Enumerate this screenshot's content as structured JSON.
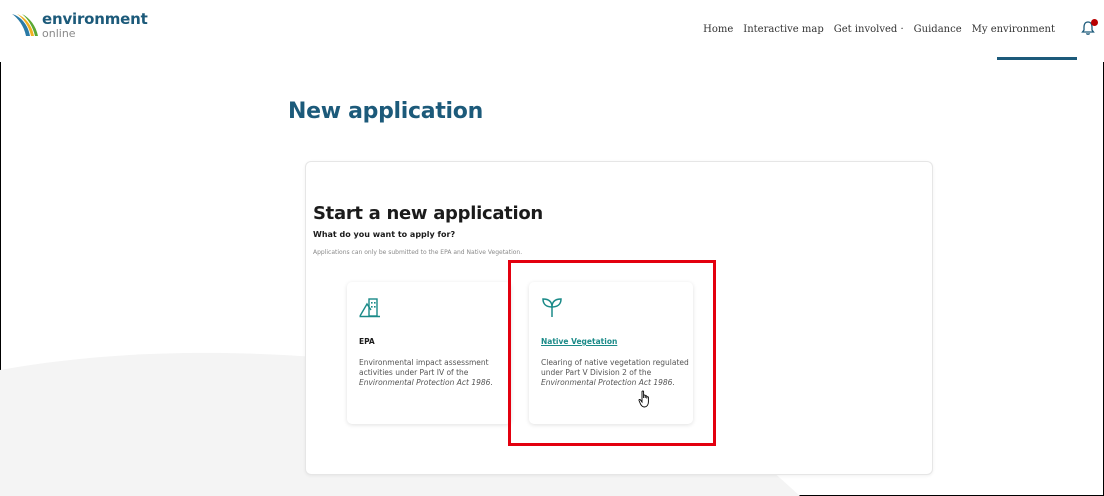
{
  "brand": {
    "name": "environment",
    "sub": "online"
  },
  "nav": {
    "items": [
      "Home",
      "Interactive map",
      "Get involved ·",
      "Guidance",
      "My environment"
    ]
  },
  "page_title": "New application",
  "section": {
    "heading": "Start a new application",
    "question": "What do you want to apply for?",
    "hint": "Applications can only be submitted to the EPA and Native Vegetation."
  },
  "cards": {
    "epa": {
      "title": "EPA",
      "desc_pre": "Environmental impact assessment activities under Part IV of the ",
      "desc_italic": "Environmental Protection Act 1986",
      "desc_post": "."
    },
    "native_vegetation": {
      "title": "Native Vegetation",
      "desc_pre": "Clearing of native vegetation regulated under Part V Division 2 of the ",
      "desc_italic": "Environmental Protection Act 1986",
      "desc_post": "."
    }
  },
  "colors": {
    "brand_blue": "#1c5a7a",
    "teal": "#1a8a88",
    "highlight_red": "#e3000f",
    "notification_dot": "#b80000"
  },
  "icons": [
    "logo-mark",
    "building-mountain-icon",
    "sprout-icon",
    "bell-icon",
    "hand-cursor-icon"
  ]
}
